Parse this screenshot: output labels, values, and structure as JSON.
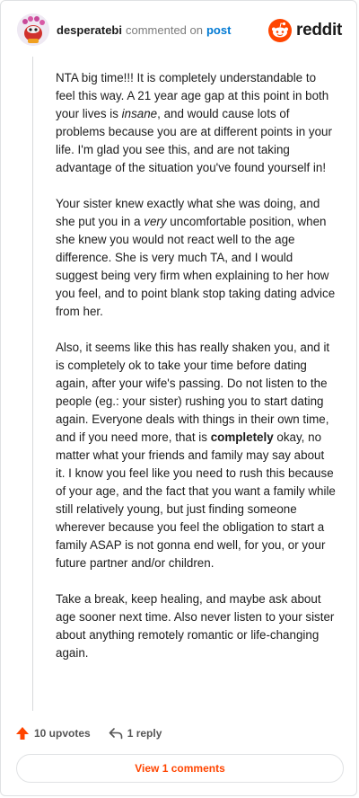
{
  "header": {
    "username": "desperatebi",
    "action_text": "commented on",
    "post_link": "post",
    "brand_name": "reddit",
    "brand_color": "#ff4500"
  },
  "comment": {
    "p1_a": "NTA big time!!! It is completely understandable to feel this way. A 21 year age gap at this point in both your lives is ",
    "p1_em": "insane",
    "p1_b": ", and would cause lots of problems because you are at different points in your life. I'm glad you see this, and are not taking advantage of the situation you've found yourself in!",
    "p2_a": "Your sister knew exactly what she was doing, and she put you in a ",
    "p2_em": "very",
    "p2_b": " uncomfortable position, when she knew you would not react well to the age difference. She is very much TA, and I would suggest being very firm when explaining to her how you feel, and to point blank stop taking dating advice from her.",
    "p3_a": "Also, it seems like this has really shaken you, and it is completely ok to take your time before dating again, after your wife's passing. Do not listen to the people (eg.: your sister) rushing you to start dating again. Everyone deals with things in their own time, and if you need more, that is ",
    "p3_strong": "completely",
    "p3_b": " okay, no matter what your friends and family may say about it. I know you feel like you need to rush this because of your age, and the fact that you want a family while still relatively young, but just finding someone wherever because you feel the obligation to start a family ASAP is not gonna end well, for you, or your future partner and/or children.",
    "p4": "Take a break, keep healing, and maybe ask about age sooner next time. Also never listen to your sister about anything remotely romantic or life-changing again."
  },
  "actions": {
    "upvotes_label": "10 upvotes",
    "replies_label": "1 reply",
    "upvote_icon": "upvote-arrow-icon",
    "reply_icon": "reply-arrow-icon",
    "upvote_color": "#ff4500"
  },
  "footer": {
    "view_comments_label": "View 1 comments"
  }
}
